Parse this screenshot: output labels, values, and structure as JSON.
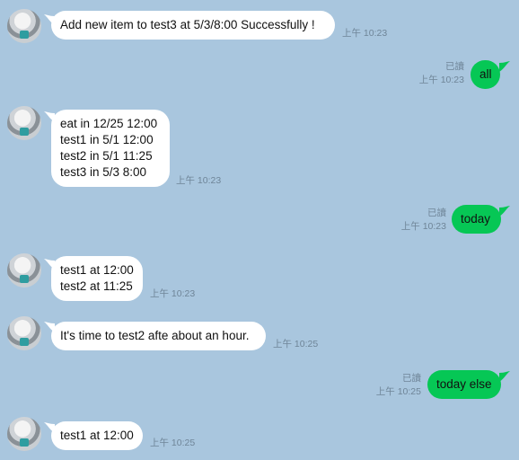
{
  "messages": [
    {
      "dir": "in",
      "text": "Add new item to test3 at 5/3/8:00 Successfully !",
      "time": "上午 10:23"
    },
    {
      "dir": "out",
      "text": "all",
      "read": "已讀",
      "time": "上午 10:23"
    },
    {
      "dir": "in",
      "text": "eat in 12/25 12:00\ntest1 in 5/1 12:00\ntest2 in 5/1 11:25\ntest3 in 5/3 8:00",
      "time": "上午 10:23"
    },
    {
      "dir": "out",
      "text": "today",
      "read": "已讀",
      "time": "上午 10:23"
    },
    {
      "dir": "in",
      "text": "test1 at 12:00\ntest2 at 11:25",
      "time": "上午 10:23"
    },
    {
      "dir": "in",
      "text": "It's time to test2 afte about an hour.",
      "time": "上午 10:25"
    },
    {
      "dir": "out",
      "text": "today else",
      "read": "已讀",
      "time": "上午 10:25"
    },
    {
      "dir": "in",
      "text": "test1 at 12:00",
      "time": "上午 10:25"
    }
  ],
  "colors": {
    "background": "#a9c6de",
    "incoming_bubble": "#ffffff",
    "outgoing_bubble": "#06c755",
    "meta_text": "#6f8598"
  }
}
